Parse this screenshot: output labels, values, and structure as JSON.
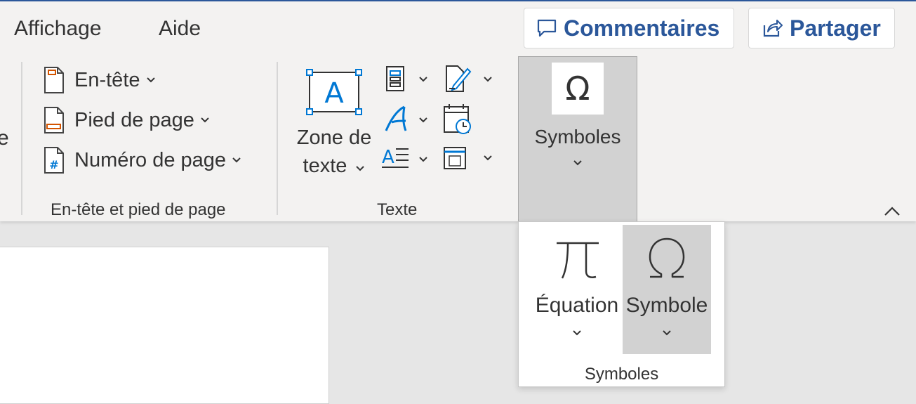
{
  "tabs": [
    "Affichage",
    "Aide"
  ],
  "commands": {
    "comments": "Commentaires",
    "share": "Partager"
  },
  "header_footer": {
    "items": [
      {
        "label": "En-tête",
        "icon": "header-page-icon"
      },
      {
        "label": "Pied de page",
        "icon": "footer-page-icon"
      },
      {
        "label": "Numéro de page",
        "icon": "page-number-icon"
      }
    ],
    "group_label": "En-tête et pied de page"
  },
  "text_group": {
    "textbox_label_line1": "Zone de",
    "textbox_label_line2": "texte",
    "group_label": "Texte"
  },
  "symbols_button": {
    "label": "Symboles",
    "icon_glyph": "Ω"
  },
  "dropdown": {
    "equation_label": "Équation",
    "symbol_label": "Symbole",
    "group_label": "Symboles"
  },
  "colors": {
    "accent": "#2b579a",
    "icon_blue": "#0078d4",
    "icon_orange": "#d35400"
  }
}
